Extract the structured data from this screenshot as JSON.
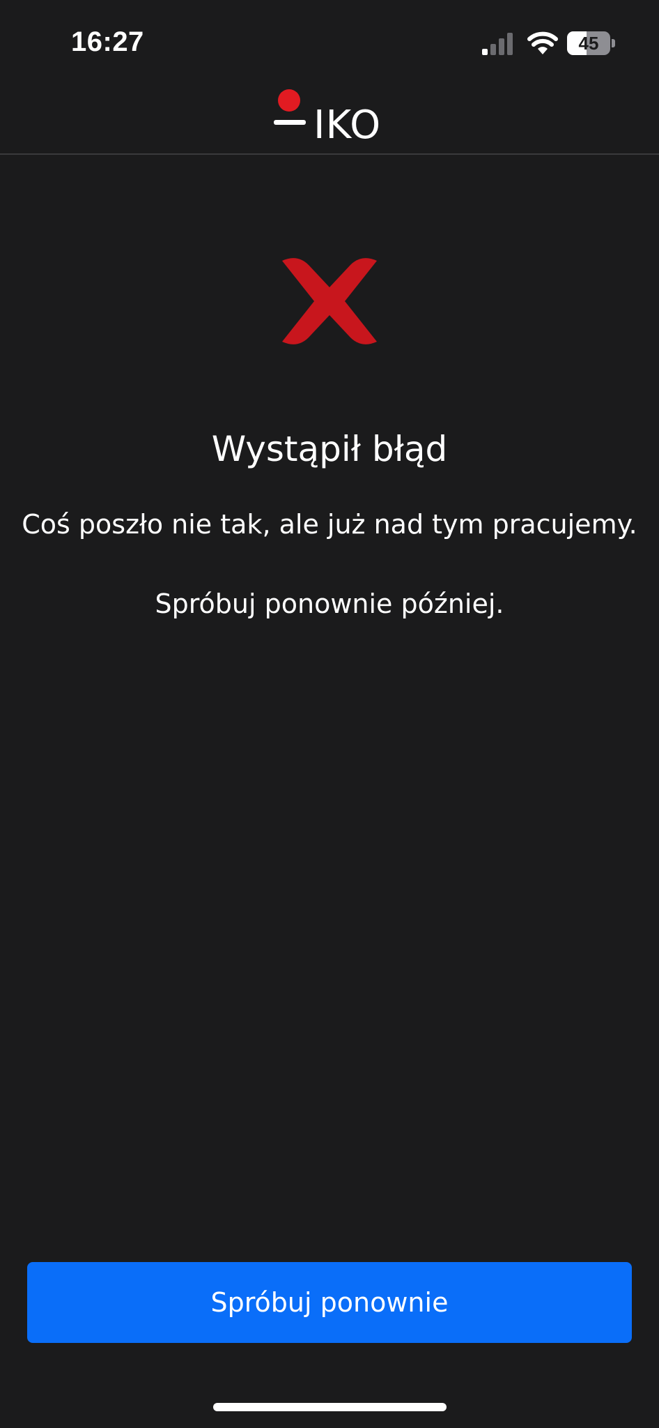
{
  "status_bar": {
    "time": "16:27",
    "battery_level": "45",
    "battery_fraction": 0.45,
    "signal_bars_active": 1,
    "signal_bars_total": 4
  },
  "header": {
    "logo_text": "IKO"
  },
  "error": {
    "icon": "close-x-icon",
    "title": "Wystąpił błąd",
    "message_1": "Coś poszło nie tak, ale już nad tym pracujemy.",
    "message_2": "Spróbuj ponownie później."
  },
  "actions": {
    "retry_label": "Spróbuj ponownie"
  },
  "colors": {
    "background": "#1b1b1c",
    "accent_red": "#e11b22",
    "button_blue": "#0a6ef9",
    "text": "#ffffff"
  }
}
